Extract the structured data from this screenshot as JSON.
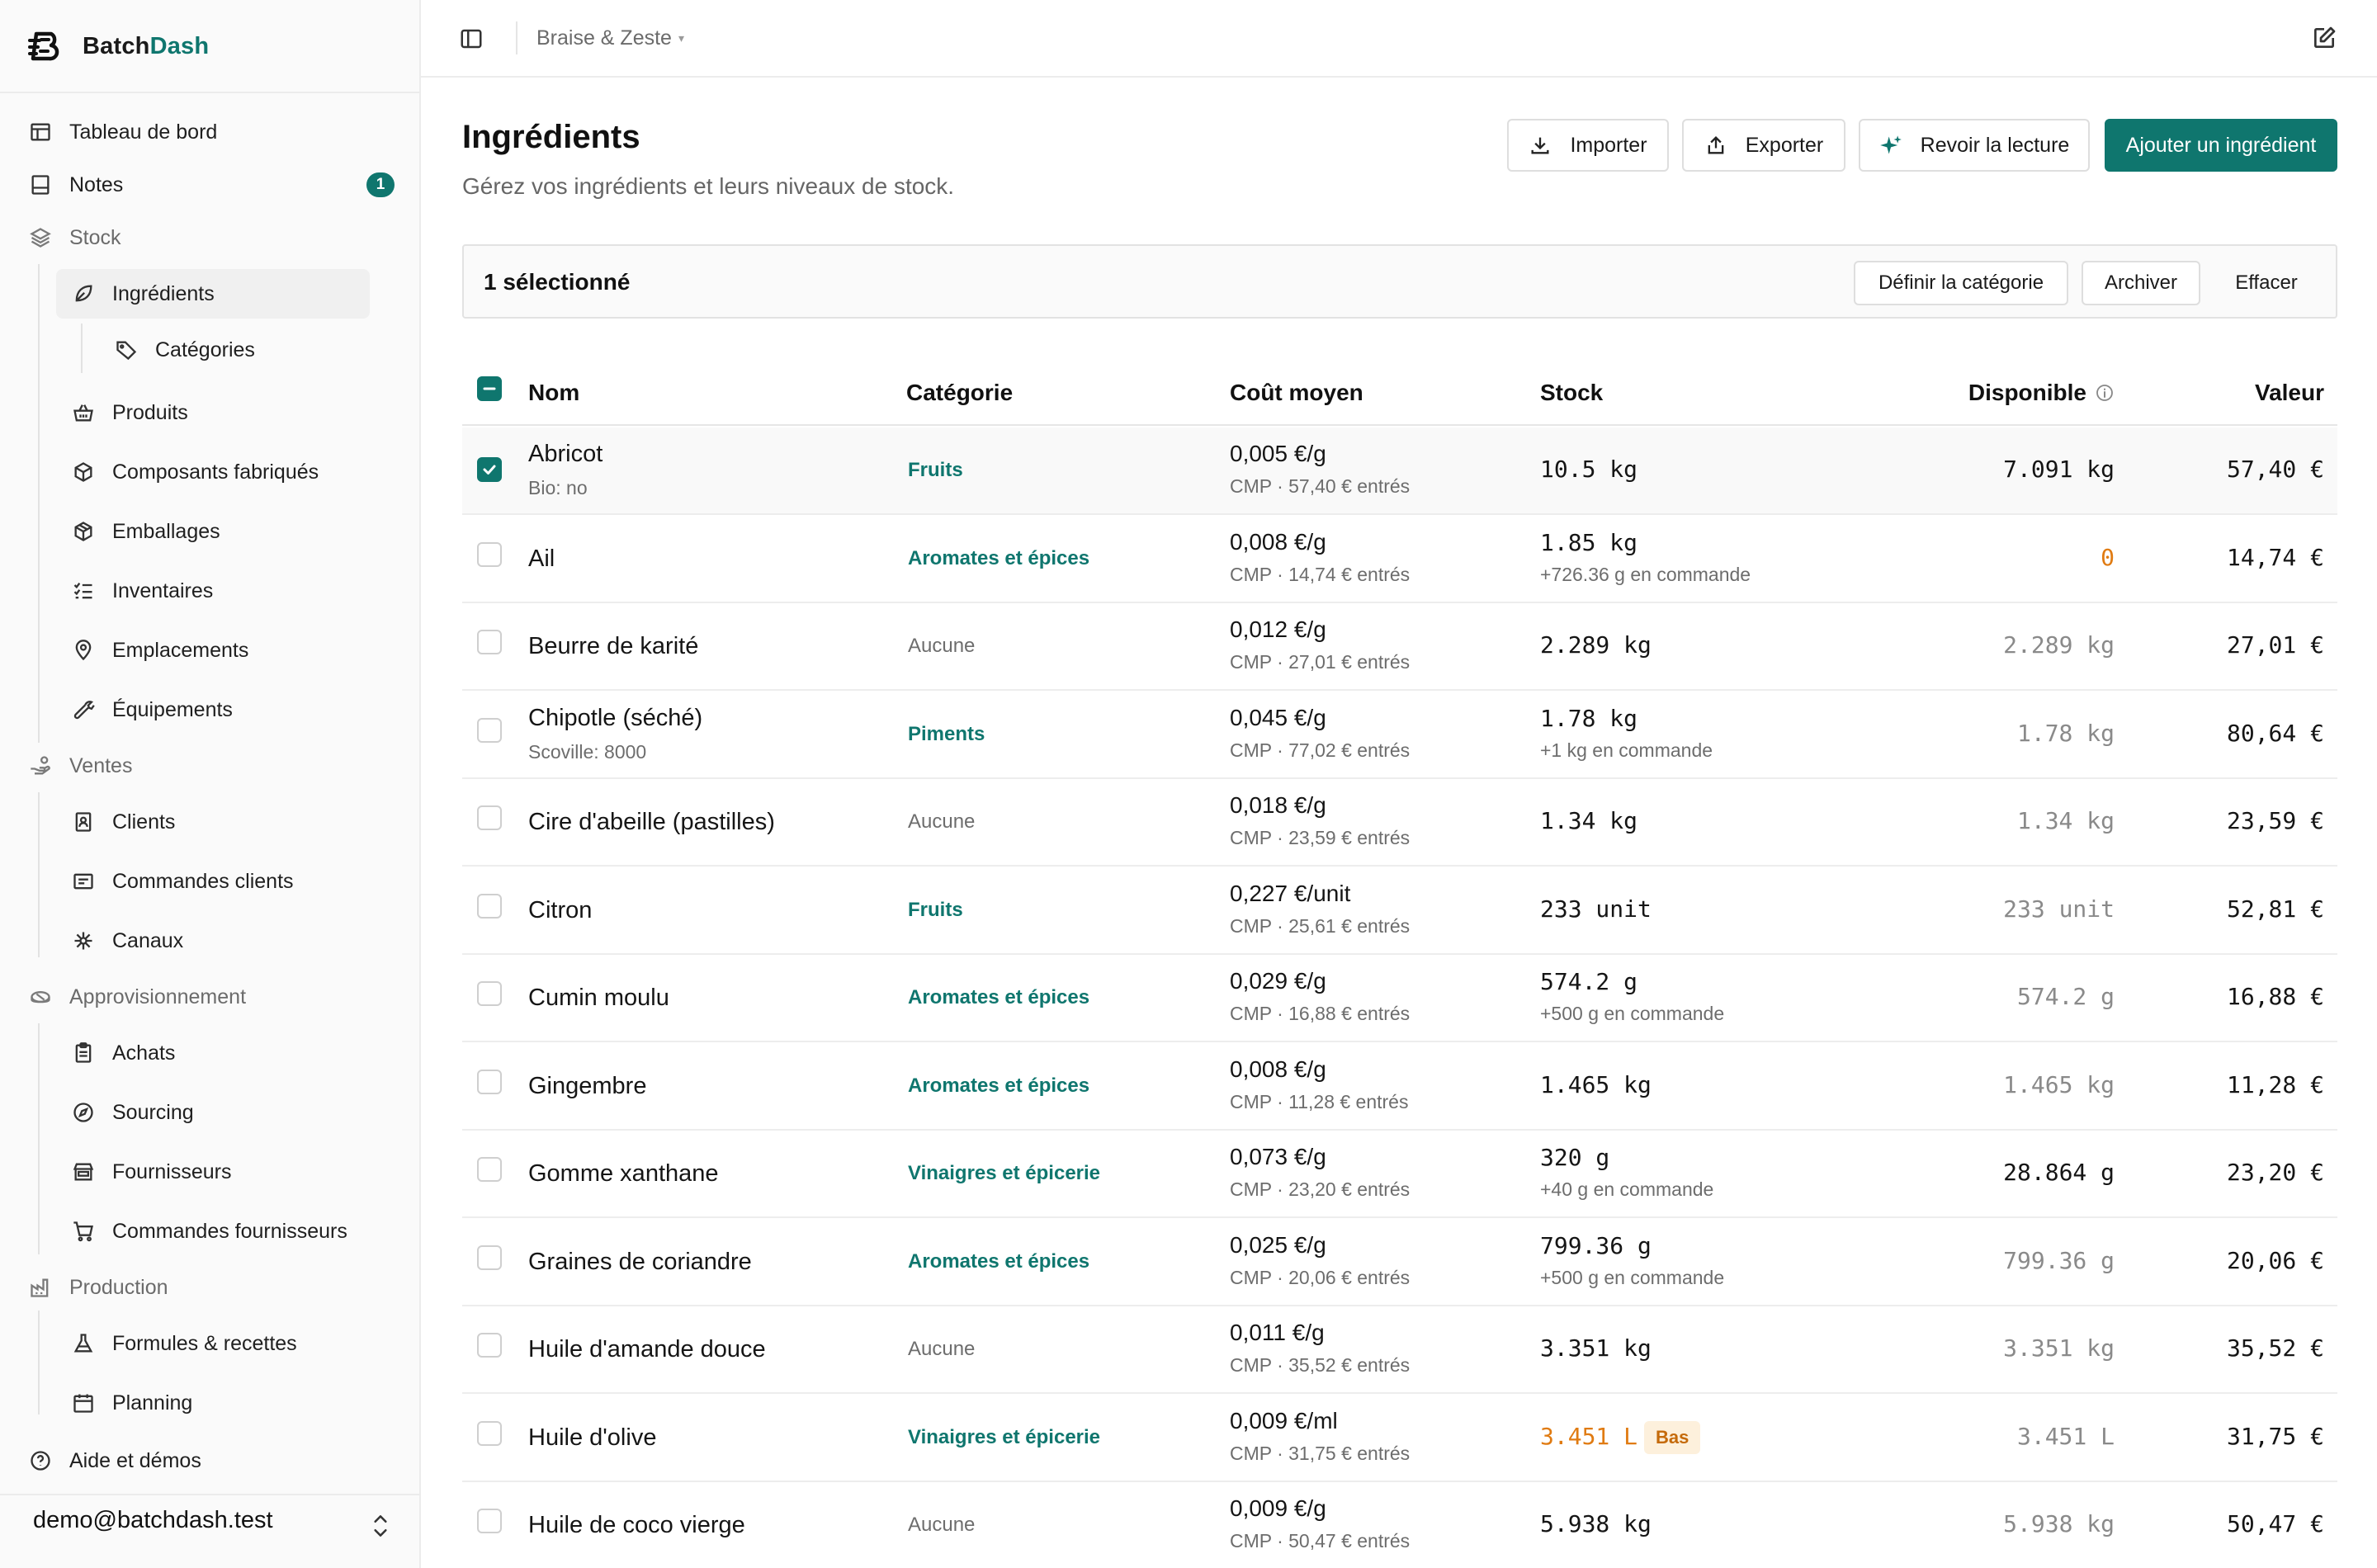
{
  "brand": {
    "name_a": "Batch",
    "name_b": "Dash"
  },
  "sidebar": {
    "dashboard": "Tableau de bord",
    "notes": "Notes",
    "notes_badge": "1",
    "stock": "Stock",
    "ingredients": "Ingrédients",
    "categories": "Catégories",
    "products": "Produits",
    "components": "Composants fabriqués",
    "packaging": "Emballages",
    "inventories": "Inventaires",
    "locations": "Emplacements",
    "equipment": "Équipements",
    "sales": "Ventes",
    "clients": "Clients",
    "client_orders": "Commandes clients",
    "channels": "Canaux",
    "supply": "Approvisionnement",
    "purchases": "Achats",
    "sourcing": "Sourcing",
    "suppliers": "Fournisseurs",
    "supplier_orders": "Commandes fournisseurs",
    "production": "Production",
    "formulas": "Formules & recettes",
    "planning": "Planning",
    "help": "Aide et démos",
    "user_email": "demo@batchdash.test"
  },
  "topbar": {
    "workspace": "Braise & Zeste",
    "caret": "▾"
  },
  "header": {
    "title": "Ingrédients",
    "subtitle": "Gérez vos ingrédients et leurs niveaux de stock.",
    "import": "Importer",
    "export": "Exporter",
    "review": "Revoir la lecture",
    "add": "Ajouter un ingrédient"
  },
  "selection": {
    "count_text": "1 sélectionné",
    "set_category": "Définir la catégorie",
    "archive": "Archiver",
    "clear": "Effacer"
  },
  "table": {
    "columns": {
      "name": "Nom",
      "category": "Catégorie",
      "cost": "Coût moyen",
      "stock": "Stock",
      "available": "Disponible",
      "value": "Valeur"
    },
    "rows": [
      {
        "name": "Abricot",
        "name_sub": "Bio: no",
        "category": "Fruits",
        "cost": "0,005 €/g",
        "cost_sub": "CMP · 57,40 € entrés",
        "stock": "10.5 kg",
        "stock_sub": "",
        "available": "7.091 kg",
        "value": "57,40 €"
      },
      {
        "name": "Ail",
        "name_sub": "",
        "category": "Aromates et épices",
        "cost": "0,008 €/g",
        "cost_sub": "CMP · 14,74 € entrés",
        "stock": "1.85 kg",
        "stock_sub": "+726.36 g en commande",
        "available": "0",
        "value": "14,74 €"
      },
      {
        "name": "Beurre de karité",
        "name_sub": "",
        "category": "Aucune",
        "cost": "0,012 €/g",
        "cost_sub": "CMP · 27,01 € entrés",
        "stock": "2.289 kg",
        "stock_sub": "",
        "available": "2.289 kg",
        "value": "27,01 €"
      },
      {
        "name": "Chipotle (séché)",
        "name_sub": "Scoville: 8000",
        "category": "Piments",
        "cost": "0,045 €/g",
        "cost_sub": "CMP · 77,02 € entrés",
        "stock": "1.78 kg",
        "stock_sub": "+1 kg en commande",
        "available": "1.78 kg",
        "value": "80,64 €"
      },
      {
        "name": "Cire d'abeille (pastilles)",
        "name_sub": "",
        "category": "Aucune",
        "cost": "0,018 €/g",
        "cost_sub": "CMP · 23,59 € entrés",
        "stock": "1.34 kg",
        "stock_sub": "",
        "available": "1.34 kg",
        "value": "23,59 €"
      },
      {
        "name": "Citron",
        "name_sub": "",
        "category": "Fruits",
        "cost": "0,227 €/unit",
        "cost_sub": "CMP · 25,61 € entrés",
        "stock": "233 unit",
        "stock_sub": "",
        "available": "233 unit",
        "value": "52,81 €"
      },
      {
        "name": "Cumin moulu",
        "name_sub": "",
        "category": "Aromates et épices",
        "cost": "0,029 €/g",
        "cost_sub": "CMP · 16,88 € entrés",
        "stock": "574.2 g",
        "stock_sub": "+500 g en commande",
        "available": "574.2 g",
        "value": "16,88 €"
      },
      {
        "name": "Gingembre",
        "name_sub": "",
        "category": "Aromates et épices",
        "cost": "0,008 €/g",
        "cost_sub": "CMP · 11,28 € entrés",
        "stock": "1.465 kg",
        "stock_sub": "",
        "available": "1.465 kg",
        "value": "11,28 €"
      },
      {
        "name": "Gomme xanthane",
        "name_sub": "",
        "category": "Vinaigres et épicerie",
        "cost": "0,073 €/g",
        "cost_sub": "CMP · 23,20 € entrés",
        "stock": "320 g",
        "stock_sub": "+40 g en commande",
        "available": "28.864 g",
        "value": "23,20 €"
      },
      {
        "name": "Graines de coriandre",
        "name_sub": "",
        "category": "Aromates et épices",
        "cost": "0,025 €/g",
        "cost_sub": "CMP · 20,06 € entrés",
        "stock": "799.36 g",
        "stock_sub": "+500 g en commande",
        "available": "799.36 g",
        "value": "20,06 €"
      },
      {
        "name": "Huile d'amande douce",
        "name_sub": "",
        "category": "Aucune",
        "cost": "0,011 €/g",
        "cost_sub": "CMP · 35,52 € entrés",
        "stock": "3.351 kg",
        "stock_sub": "",
        "available": "3.351 kg",
        "value": "35,52 €"
      },
      {
        "name": "Huile d'olive",
        "name_sub": "",
        "category": "Vinaigres et épicerie",
        "cost": "0,009 €/ml",
        "cost_sub": "CMP · 31,75 € entrés",
        "stock": "3.451 L",
        "stock_sub": "",
        "stock_badge": "Bas",
        "available": "3.451 L",
        "value": "31,75 €"
      },
      {
        "name": "Huile de coco vierge",
        "name_sub": "",
        "category": "Aucune",
        "cost": "0,009 €/g",
        "cost_sub": "CMP · 50,47 € entrés",
        "stock": "5.938 kg",
        "stock_sub": "",
        "available": "5.938 kg",
        "value": "50,47 €"
      }
    ]
  },
  "colors": {
    "accent": "#0f766e",
    "warning": "#e07b12"
  }
}
